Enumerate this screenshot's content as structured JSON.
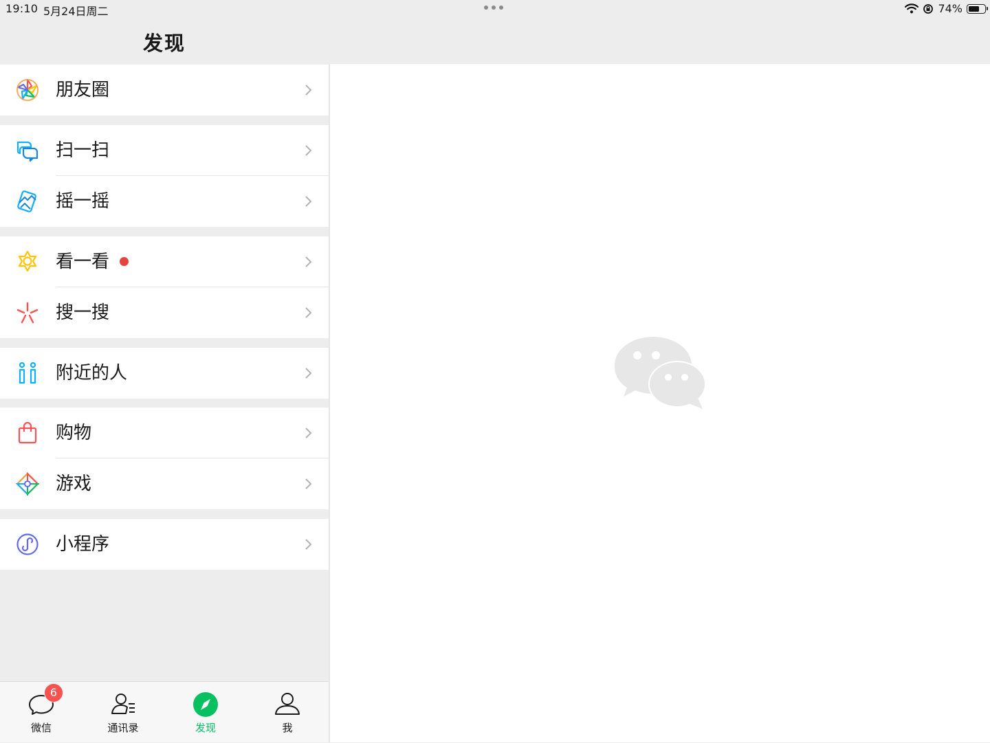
{
  "status_bar": {
    "time": "19:10",
    "date": "5月24日周二",
    "battery_text": "74%",
    "battery_level": 0.74
  },
  "header": {
    "title": "发现"
  },
  "groups": [
    {
      "items": [
        {
          "label": "朋友圈",
          "icon": "moments-icon"
        }
      ]
    },
    {
      "items": [
        {
          "label": "扫一扫",
          "icon": "scan-icon"
        },
        {
          "label": "摇一摇",
          "icon": "shake-icon"
        }
      ]
    },
    {
      "items": [
        {
          "label": "看一看",
          "icon": "top-stories-icon",
          "has_dot": true
        },
        {
          "label": "搜一搜",
          "icon": "search-icon"
        }
      ]
    },
    {
      "items": [
        {
          "label": "附近的人",
          "icon": "people-nearby-icon"
        }
      ]
    },
    {
      "items": [
        {
          "label": "购物",
          "icon": "shopping-bag-icon"
        },
        {
          "label": "游戏",
          "icon": "games-icon"
        }
      ]
    },
    {
      "items": [
        {
          "label": "小程序",
          "icon": "mini-programs-icon"
        }
      ]
    }
  ],
  "tabbar": {
    "tabs": [
      {
        "label": "微信",
        "icon": "chat-bubble-icon",
        "badge": "6"
      },
      {
        "label": "通讯录",
        "icon": "contacts-icon"
      },
      {
        "label": "发现",
        "icon": "compass-icon",
        "active": true
      },
      {
        "label": "我",
        "icon": "person-icon"
      }
    ]
  },
  "colors": {
    "accent": "#07c160",
    "badge": "#fa5151",
    "dot": "#e64340",
    "background": "#ededed"
  }
}
